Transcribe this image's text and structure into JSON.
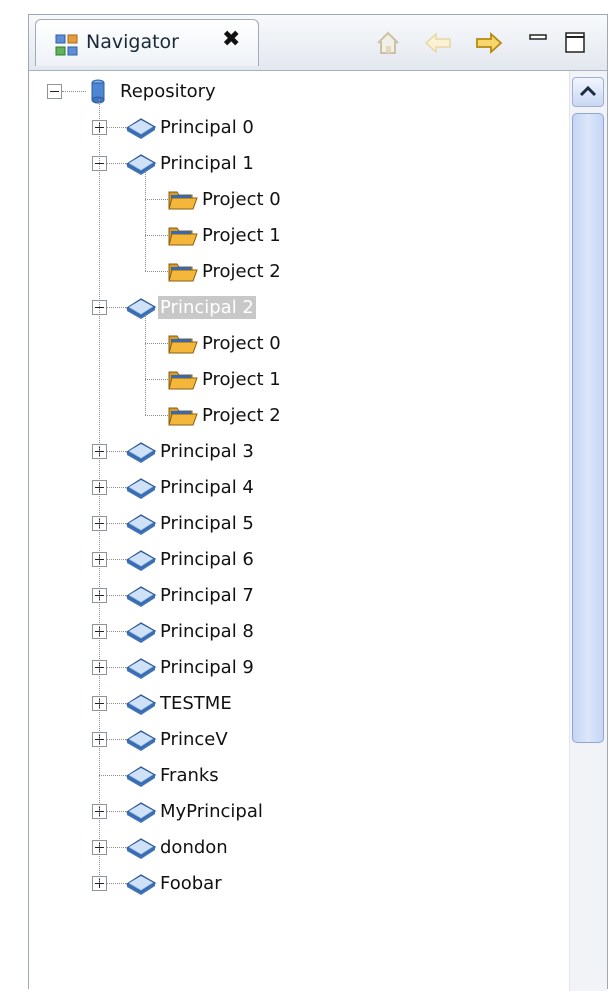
{
  "tab": {
    "title": "Navigator",
    "close_glyph": "✖",
    "icon": "navigator-icon"
  },
  "toolbar": {
    "home_icon": "home-icon",
    "back_icon": "back-arrow-icon",
    "forward_icon": "forward-arrow-icon",
    "minimize_icon": "minimize-icon",
    "maximize_icon": "maximize-icon"
  },
  "tree": {
    "root": "Repository",
    "nodes": [
      {
        "label": "Principal 0",
        "expanded": false,
        "children": []
      },
      {
        "label": "Principal 1",
        "expanded": true,
        "children": [
          "Project 0",
          "Project 1",
          "Project 2"
        ]
      },
      {
        "label": "Principal 2",
        "expanded": true,
        "selected": true,
        "children": [
          "Project 0",
          "Project 1",
          "Project 2"
        ]
      },
      {
        "label": "Principal 3",
        "expanded": false,
        "children": []
      },
      {
        "label": "Principal 4",
        "expanded": false,
        "children": []
      },
      {
        "label": "Principal 5",
        "expanded": false,
        "children": []
      },
      {
        "label": "Principal 6",
        "expanded": false,
        "children": []
      },
      {
        "label": "Principal 7",
        "expanded": false,
        "children": []
      },
      {
        "label": "Principal 8",
        "expanded": false,
        "children": []
      },
      {
        "label": "Principal 9",
        "expanded": false,
        "children": []
      },
      {
        "label": "TESTME",
        "expanded": false,
        "children": []
      },
      {
        "label": "PrinceV",
        "expanded": false,
        "children": []
      },
      {
        "label": "Franks",
        "expanded": false,
        "leaf": true,
        "children": []
      },
      {
        "label": "MyPrincipal",
        "expanded": false,
        "children": []
      },
      {
        "label": "dondon",
        "expanded": false,
        "children": []
      },
      {
        "label": "Foobar",
        "expanded": false,
        "children": []
      }
    ]
  },
  "colors": {
    "selection": "#c8c8c8",
    "tab_border": "#a0aab8",
    "scroll_thumb": "#c5d5f4",
    "folder": "#f5b73b",
    "principal_icon": "#5b8fd6"
  }
}
